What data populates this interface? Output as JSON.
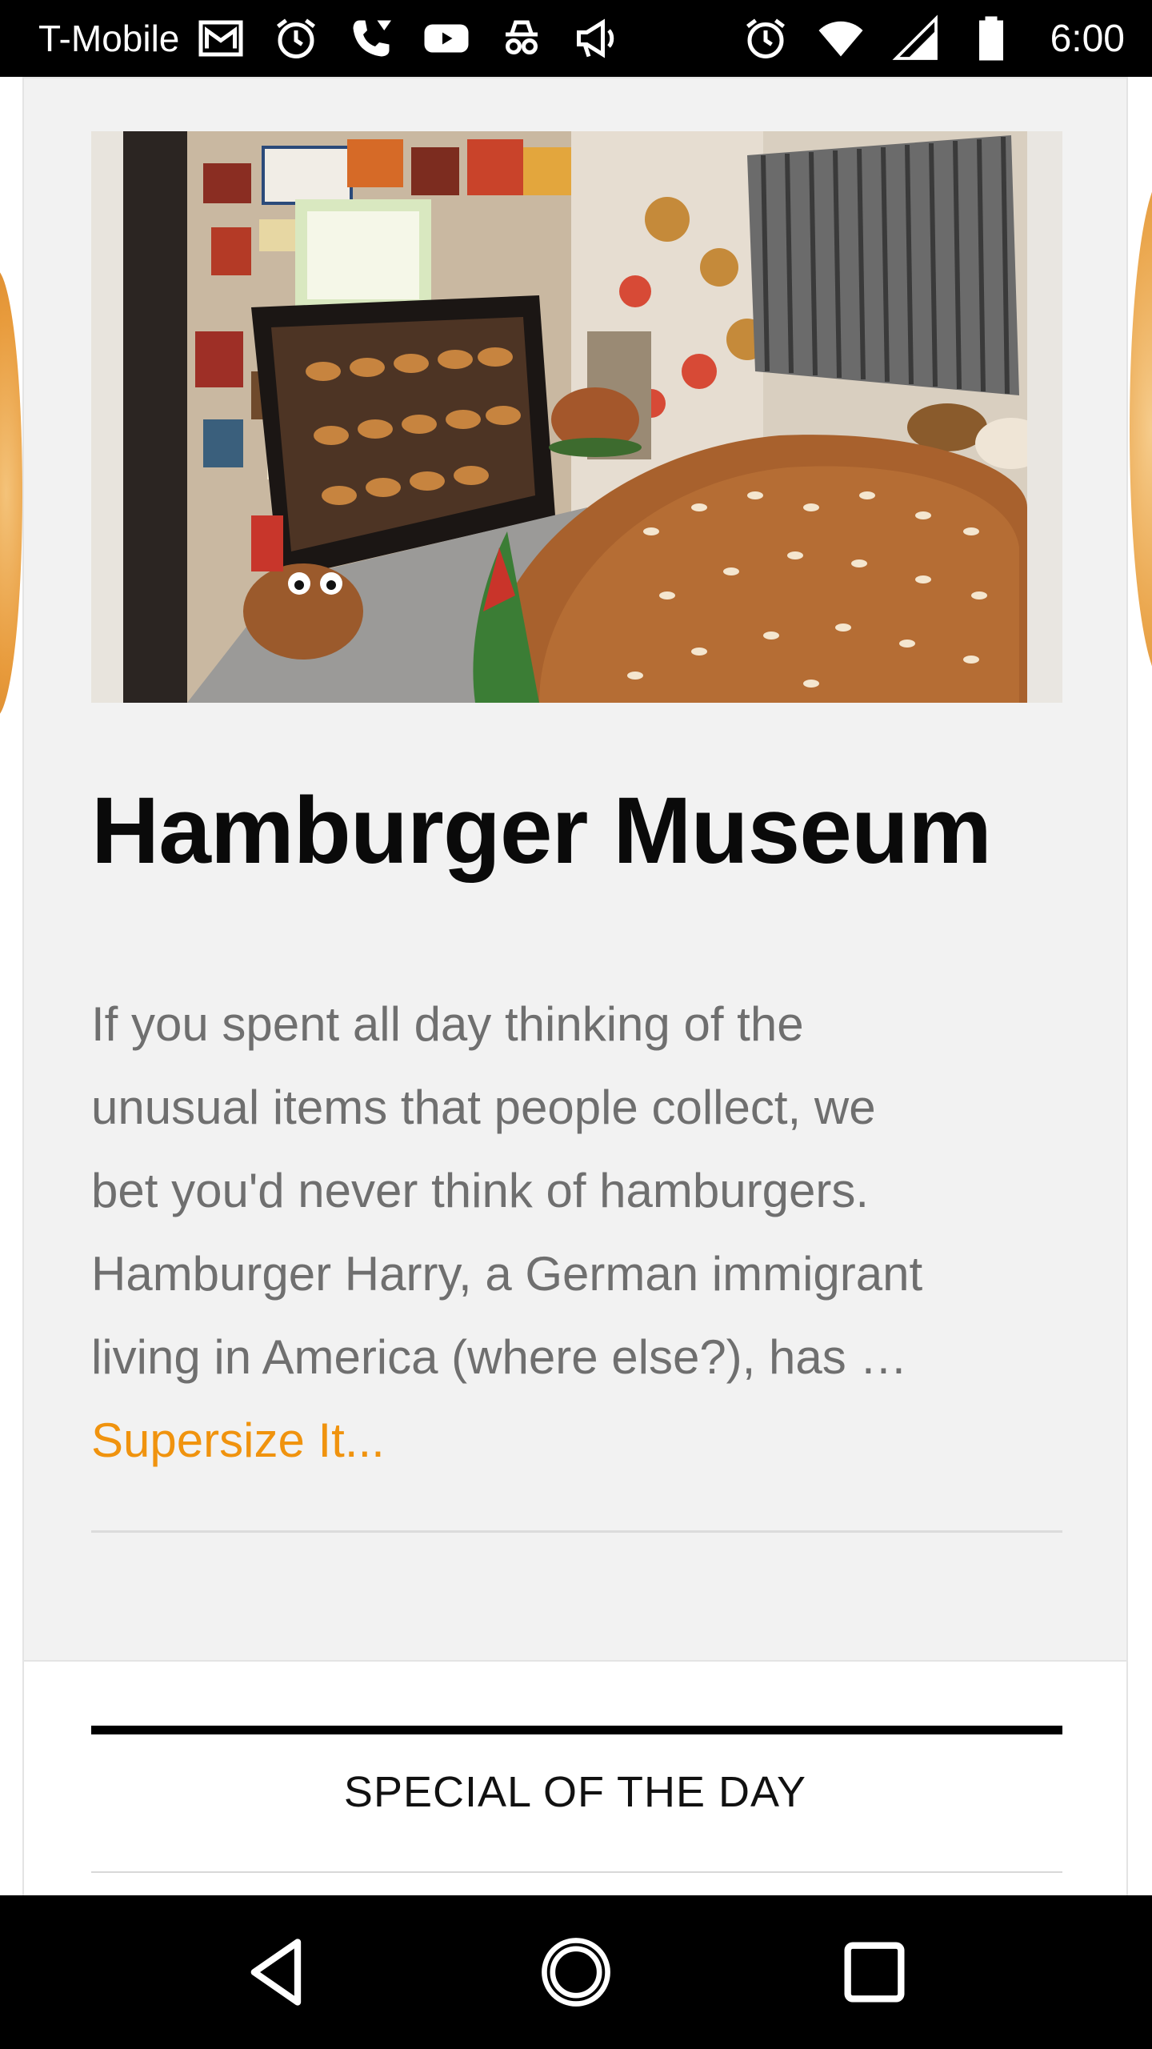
{
  "status_bar": {
    "carrier": "T-Mobile",
    "time": "6:00",
    "left_icons": [
      "gmail-icon",
      "alarm-icon",
      "wifi-calling-icon",
      "youtube-icon",
      "incognito-icon",
      "announcement-icon"
    ],
    "right_icons": [
      "alarm-icon",
      "wifi-icon",
      "cell-signal-icon",
      "battery-icon"
    ]
  },
  "article": {
    "image_icon": "hamburger-museum-photo",
    "title": "Hamburger Museum",
    "excerpt_lines": [
      "If you spent all day thinking of the",
      "unusual items that people collect, we",
      "bet you'd never think of hamburgers.",
      "Hamburger Harry, a German immigrant",
      "living in America (where else?), has …"
    ],
    "more_link": "Supersize It...",
    "link_color": "#f0930e"
  },
  "widget": {
    "heading": "SPECIAL OF THE DAY"
  },
  "nav_bar": {
    "buttons": [
      "back-icon",
      "home-icon",
      "recents-icon"
    ]
  }
}
